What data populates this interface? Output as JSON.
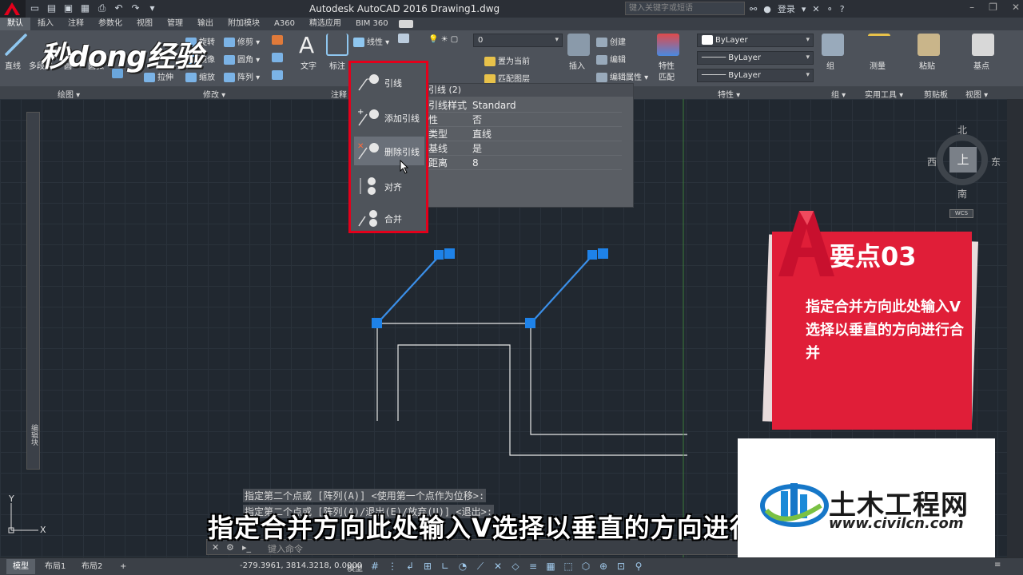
{
  "titlebar": {
    "app_title": "Autodesk AutoCAD 2016    Drawing1.dwg",
    "search_placeholder": "键入关键字或短语",
    "login": "登录"
  },
  "tabs": [
    {
      "label": "默认",
      "active": true
    },
    {
      "label": "插入"
    },
    {
      "label": "注释"
    },
    {
      "label": "参数化"
    },
    {
      "label": "视图"
    },
    {
      "label": "管理"
    },
    {
      "label": "输出"
    },
    {
      "label": "附加模块"
    },
    {
      "label": "A360"
    },
    {
      "label": "精选应用"
    },
    {
      "label": "BIM 360"
    }
  ],
  "ribbon": {
    "draw": {
      "line": "直线",
      "polyline": "多段线",
      "circle": "圆",
      "arc": "圆弧"
    },
    "modify": {
      "rotate": "旋转",
      "trim": "修剪",
      "mirror": "镜像",
      "fillet": "圆角",
      "stretch": "拉伸",
      "scale": "缩放",
      "array": "阵列"
    },
    "annotation": {
      "text": "文字",
      "dim": "标注",
      "linear": "线性",
      "leader": "引线"
    },
    "layers": {
      "layer_value": "0",
      "set_current": "置为当前",
      "match_layer": "匹配图层"
    },
    "block": {
      "insert": "插入",
      "create": "创建",
      "edit": "编辑",
      "edit_attr": "编辑属性"
    },
    "properties": {
      "match": "特性\n匹配",
      "match_top": "特性",
      "match_bottom": "匹配",
      "color": "ByLayer",
      "linetype": "ByLayer",
      "lineweight": "ByLayer"
    },
    "group": {
      "label": "组"
    },
    "utilities": {
      "measure": "测量"
    },
    "clipboard": {
      "paste": "粘贴"
    },
    "view": {
      "base": "基点"
    },
    "panel_labels": {
      "draw": "绘图 ▾",
      "modify": "修改 ▾",
      "annotation": "注释",
      "properties": "特性 ▾",
      "group": "组 ▾",
      "utilities": "实用工具 ▾",
      "clipboard": "剪贴板",
      "view": "视图 ▾"
    }
  },
  "brand_logo": "秒dong经验",
  "flyout": {
    "items": [
      {
        "label": "引线"
      },
      {
        "label": "添加引线"
      },
      {
        "label": "删除引线",
        "highlighted": true
      },
      {
        "label": "对齐"
      },
      {
        "label": "合并"
      }
    ]
  },
  "properties_panel": {
    "title": "引线 (2)",
    "rows": [
      {
        "key": "引线样式",
        "value": "Standard"
      },
      {
        "key": "性",
        "value": "否"
      },
      {
        "key": "类型",
        "value": "直线"
      },
      {
        "key": "基线",
        "value": "是"
      },
      {
        "key": "距离",
        "value": "8"
      }
    ]
  },
  "left_palette": {
    "label": "编辑块"
  },
  "compass": {
    "north": "北",
    "south": "南",
    "west": "西",
    "east": "东",
    "top": "上",
    "wcs": "WCS"
  },
  "keypoint": {
    "title": "要点03",
    "text": "指定合并方向此处输入V选择以垂直的方向进行合并"
  },
  "command": {
    "history": [
      "指定第二个点或 [阵列(A)] <使用第一个点作为位移>:",
      "指定第二个点或 [阵列(A)/退出(E)/放弃(U)] <退出>:"
    ],
    "placeholder": "键入命令"
  },
  "subtitle": "指定合并方向此处输入V选择以垂直的方向进行合并",
  "watermark": {
    "brand": "土木工程网",
    "url": "www.civilcn.com"
  },
  "statusbar": {
    "tabs": [
      {
        "label": "模型",
        "active": true
      },
      {
        "label": "布局1"
      },
      {
        "label": "布局2"
      },
      {
        "label": "+"
      }
    ],
    "coords": "-279.3961, 3814.3218, 0.0000",
    "model": "模型"
  },
  "colors": {
    "accent_red": "#e01e38",
    "grip_blue": "#1e82e8",
    "leader_blue": "#3b8fe8"
  }
}
